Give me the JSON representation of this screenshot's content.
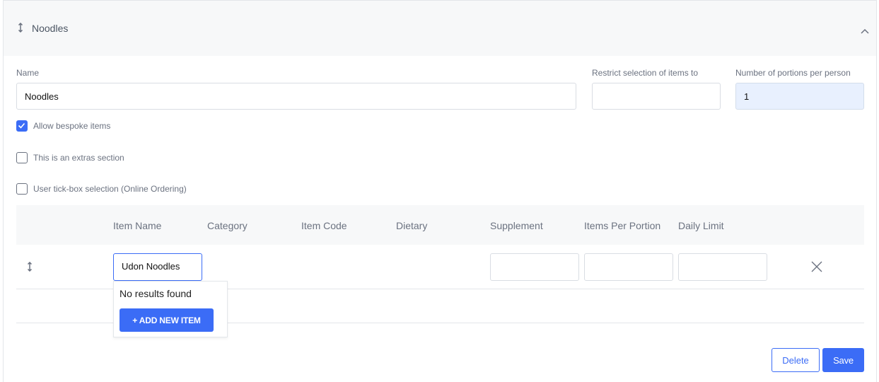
{
  "section": {
    "title": "Noodles"
  },
  "form": {
    "name_label": "Name",
    "name_value": "Noodles",
    "restrict_label": "Restrict selection of items to",
    "restrict_value": "",
    "portions_label": "Number of portions per person",
    "portions_value": "1",
    "checkboxes": [
      {
        "label": "Allow bespoke items",
        "checked": true
      },
      {
        "label": "This is an extras section",
        "checked": false
      },
      {
        "label": "User tick-box selection (Online Ordering)",
        "checked": false
      }
    ]
  },
  "table": {
    "headers": [
      "Item Name",
      "Category",
      "Item Code",
      "Dietary",
      "Supplement",
      "Items Per Portion",
      "Daily Limit"
    ],
    "row": {
      "item_name": "Udon Noodles",
      "supplement": "",
      "items_per_portion": "",
      "daily_limit": ""
    }
  },
  "dropdown": {
    "message": "No results found",
    "add_button": "+ ADD NEW ITEM"
  },
  "actions": {
    "delete": "Delete",
    "save": "Save"
  },
  "icons": {
    "drag": "drag-handle-icon",
    "collapse": "chevron-up-icon",
    "remove": "close-icon",
    "check": "checkmark-icon"
  },
  "colors": {
    "accent": "#3b6cf6",
    "header_bg": "#f7f8f9",
    "highlight_input": "#e8f0fe"
  }
}
